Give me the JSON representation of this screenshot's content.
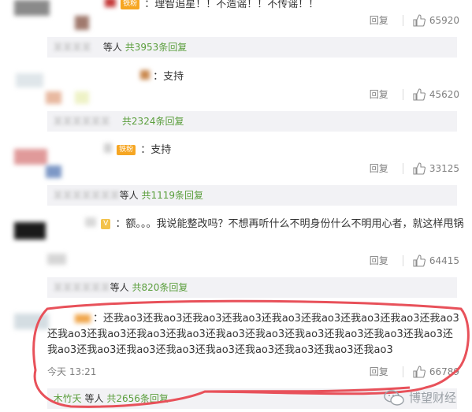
{
  "comments": [
    {
      "text": "：理智追星！！不造谣！！不传谣！！",
      "reply_label": "回复",
      "likes": "65920",
      "reply_bar": {
        "name_suffix": "等人",
        "count_text": "共3953条回复"
      }
    },
    {
      "text": "：支持",
      "reply_label": "回复",
      "likes": "45620",
      "reply_bar": {
        "name_suffix": "",
        "count_text": "共2324条回复"
      }
    },
    {
      "badge": "铁粉",
      "text": "：支持",
      "reply_label": "回复",
      "likes": "33125",
      "reply_bar": {
        "name_suffix": "等人",
        "count_text": "共1119条回复"
      }
    },
    {
      "text": "：额。。。我说能整改吗？不想再听什么不明身份什么不明用心者，就这样甩锅",
      "reply_label": "回复",
      "likes": "64415",
      "reply_bar": {
        "name_suffix": "等人",
        "count_text": "共820条回复"
      }
    },
    {
      "text": "：还我ao3还我ao3还我ao3还我ao3还我ao3还我ao3还我ao3还我ao3还我ao3还我ao3还我ao3还我ao3还我ao3还我ao3还我ao3还我ao3还我ao3还我ao3还我ao3还我ao3还我ao3还我ao3还我ao3还我ao3还我ao3还我ao3还我ao3还我ao3",
      "timestamp": "今天 13:21",
      "reply_label": "回复",
      "likes": "66789",
      "reply_bar": {
        "name": "木竹夭",
        "name_suffix": "等人",
        "count_text": "共2656条回复"
      }
    }
  ],
  "first_badge": "铁粉",
  "watermark": {
    "text": "博望财经"
  },
  "colors": {
    "link_green": "#5a9e3c",
    "highlight_red": "#e8515a",
    "badge_orange": "#f6a623"
  }
}
